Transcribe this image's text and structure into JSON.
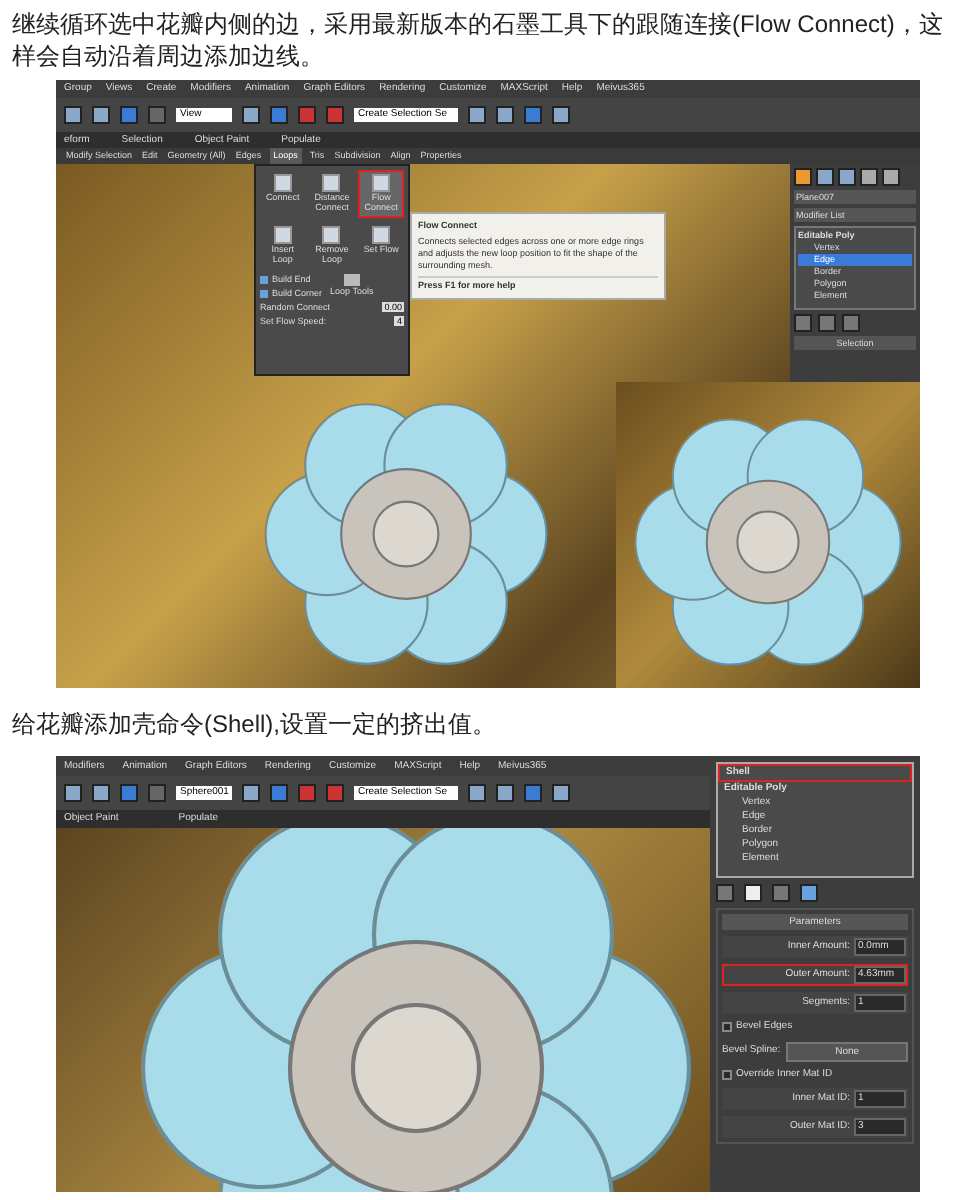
{
  "paragraphs": [
    "继续循环选中花瓣内侧的边，采用最新版本的石墨工具下的跟随连接(Flow Connect)，这样会自动沿着周边添加边线。",
    "给花瓣添加壳命令(Shell),设置一定的挤出值。"
  ],
  "shot1": {
    "menu": [
      "Group",
      "Views",
      "Create",
      "Modifiers",
      "Animation",
      "Graph Editors",
      "Rendering",
      "Customize",
      "MAXScript",
      "Help",
      "Meivus365"
    ],
    "toolbar_dropdowns": [
      "View",
      "Create Selection Se"
    ],
    "ribbon_tabs": [
      "eform",
      "Selection",
      "Object Paint",
      "Populate"
    ],
    "ribbon_panels": [
      {
        "label": "Modify Selection",
        "selected": false
      },
      {
        "label": "Edit",
        "selected": false
      },
      {
        "label": "Geometry (All)",
        "selected": false
      },
      {
        "label": "Edges",
        "selected": false
      },
      {
        "label": "Loops",
        "selected": true
      },
      {
        "label": "Tris",
        "selected": false
      },
      {
        "label": "Subdivision",
        "selected": false
      },
      {
        "label": "Align",
        "selected": false
      },
      {
        "label": "Properties",
        "selected": false
      }
    ],
    "loops_tools": [
      {
        "label": "Connect",
        "highlighted": false
      },
      {
        "label": "Distance Connect",
        "highlighted": false
      },
      {
        "label": "Flow Connect",
        "highlighted": true
      },
      {
        "label": "Insert Loop",
        "highlighted": false
      },
      {
        "label": "Remove Loop",
        "highlighted": false
      },
      {
        "label": "Set Flow",
        "highlighted": false
      }
    ],
    "loops_list": [
      "Build End",
      "Build Corner"
    ],
    "loop_tools_button": "Loop Tools",
    "spinners": [
      {
        "label": "Random Connect",
        "value": "0.00"
      },
      {
        "label": "Set Flow Speed:",
        "value": "4"
      }
    ],
    "tooltip": {
      "title": "Flow Connect",
      "body": "Connects selected edges across one or more edge rings and adjusts the new loop position to fit the shape of the surrounding mesh.",
      "help": "Press F1 for more help"
    },
    "command_panel": {
      "object_name": "Plane007",
      "modifier_list": "Modifier List",
      "stack": [
        {
          "label": "Editable Poly",
          "selected": false,
          "children": [
            {
              "label": "Vertex",
              "selected": false
            },
            {
              "label": "Edge",
              "selected": true
            },
            {
              "label": "Border",
              "selected": false
            },
            {
              "label": "Polygon",
              "selected": false
            },
            {
              "label": "Element",
              "selected": false
            }
          ]
        }
      ],
      "rollout": "Selection"
    }
  },
  "shot2": {
    "menu": [
      "Modifiers",
      "Animation",
      "Graph Editors",
      "Rendering",
      "Customize",
      "MAXScript",
      "Help",
      "Meivus365"
    ],
    "toolbar_dropdowns": [
      "Sphere001",
      "Create Selection Se"
    ],
    "ribbon_tabs": [
      "Object Paint",
      "Populate"
    ],
    "stack": [
      {
        "label": "Shell",
        "highlighted": true
      },
      {
        "label": "Editable Poly",
        "highlighted": false,
        "children": [
          {
            "label": "Vertex"
          },
          {
            "label": "Edge"
          },
          {
            "label": "Border"
          },
          {
            "label": "Polygon"
          },
          {
            "label": "Element"
          }
        ]
      }
    ],
    "rollout": "Parameters",
    "params": [
      {
        "kind": "spinner",
        "label": "Inner Amount:",
        "value": "0.0mm",
        "highlighted": false
      },
      {
        "kind": "spinner",
        "label": "Outer Amount:",
        "value": "4.63mm",
        "highlighted": true
      },
      {
        "kind": "spinner",
        "label": "Segments:",
        "value": "1",
        "highlighted": false
      },
      {
        "kind": "checkbox",
        "label": "Bevel Edges",
        "checked": false
      },
      {
        "kind": "button",
        "label": "Bevel Spline:",
        "value": "None"
      },
      {
        "kind": "checkbox",
        "label": "Override Inner Mat ID",
        "checked": false
      },
      {
        "kind": "spinner",
        "label": "Inner Mat ID:",
        "value": "1",
        "highlighted": false
      },
      {
        "kind": "spinner",
        "label": "Outer Mat ID:",
        "value": "3",
        "highlighted": false
      }
    ]
  }
}
